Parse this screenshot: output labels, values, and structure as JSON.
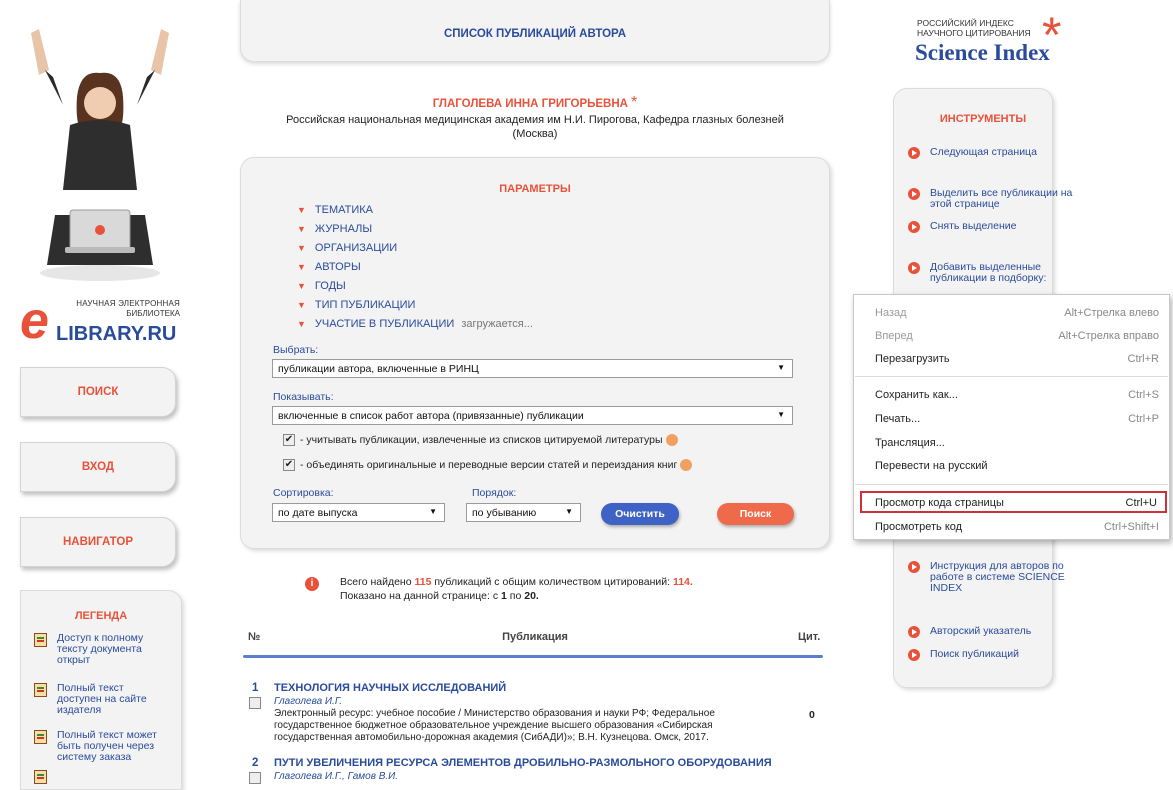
{
  "header": {
    "title": "СПИСОК ПУБЛИКАЦИЙ АВТОРА"
  },
  "logo": {
    "line1": "НАУЧНАЯ ЭЛЕКТРОННАЯ",
    "line2": "БИБЛИОТЕКА",
    "brand": "LIBRARY.RU",
    "brand_letter": "e"
  },
  "science_index": {
    "line1": "РОССИЙСКИЙ ИНДЕКС",
    "line2": "НАУЧНОГО ЦИТИРОВАНИЯ",
    "title": "Science Index",
    "asterisk": "*"
  },
  "nav": {
    "search": "ПОИСК",
    "login": "ВХОД",
    "navigator": "НАВИГАТОР"
  },
  "author": {
    "name": "ГЛАГОЛЕВА ИННА ГРИГОРЬЕВНА",
    "asterisk": "*",
    "affiliation": "Российская национальная медицинская академия им Н.И. Пирогова, Кафедра глазных болезней",
    "city": "(Москва)"
  },
  "params": {
    "title": "ПАРАМЕТРЫ",
    "items": [
      "ТЕМАТИКА",
      "ЖУРНАЛЫ",
      "ОРГАНИЗАЦИИ",
      "АВТОРЫ",
      "ГОДЫ",
      "ТИП ПУБЛИКАЦИИ",
      "УЧАСТИЕ В ПУБЛИКАЦИИ"
    ],
    "loading": "загружается...",
    "select_label": "Выбрать:",
    "select_value": "публикации автора, включенные в РИНЦ",
    "show_label": "Показывать:",
    "show_value": "включенные в список работ автора (привязанные) публикации",
    "check1": "- учитывать публикации, извлеченные из списков цитируемой литературы",
    "check2": "- объединять оригинальные и переводные версии статей и переиздания книг",
    "check_mark": "✔",
    "sort_label": "Сортировка:",
    "sort_value": "по дате выпуска",
    "order_label": "Порядок:",
    "order_value": "по убыванию",
    "clear_button": "Очистить",
    "search_button": "Поиск",
    "arrow": "▼",
    "tri": "▼"
  },
  "summary": {
    "part1": "Всего найдено",
    "total": "115",
    "part2": "публикаций с общим количеством цитирований:",
    "citations": "114.",
    "line2a": "Показано на данной странице: с",
    "from": "1",
    "line2b": "по",
    "to": "20."
  },
  "table": {
    "col_num": "№",
    "col_pub": "Публикация",
    "col_cit": "Цит.",
    "rows": [
      {
        "num": "1",
        "title": "ТЕХНОЛОГИЯ НАУЧНЫХ ИССЛЕДОВАНИЙ",
        "authors": "Глаголева И.Г.",
        "desc1": "Электронный ресурс: учебное пособие / Министерство образования и науки РФ; Федеральное",
        "desc2": "государственное бюджетное образовательное учреждение высшего образования «Сибирская",
        "desc3": "государственная автомобильно-дорожная академия (СибАДИ)»; В.Н. Кузнецова. Омск, 2017.",
        "cit": "0"
      },
      {
        "num": "2",
        "title": "ПУТИ УВЕЛИЧЕНИЯ РЕСУРСА ЭЛЕМЕНТОВ ДРОБИЛЬНО-РАЗМОЛЬНОГО ОБОРУДОВАНИЯ",
        "authors": "Глаголева И.Г., Гамов В.И."
      }
    ]
  },
  "tools": {
    "title": "ИНСТРУМЕНТЫ",
    "next": "Следующая страница",
    "select_all_1": "Выделить все публикации на",
    "select_all_2": "этой странице",
    "deselect": "Снять выделение",
    "add_1": "Добавить выделенные",
    "add_2": "публикации в подборку:",
    "instr_1": "Инструкция для авторов по",
    "instr_2": "работе в системе SCIENCE",
    "instr_3": "INDEX",
    "author_index": "Авторский указатель",
    "pub_search": "Поиск публикаций"
  },
  "legend": {
    "title": "ЛЕГЕНДА",
    "items": [
      {
        "l1": "Доступ к полному",
        "l2": "тексту документа",
        "l3": "открыт"
      },
      {
        "l1": "Полный текст",
        "l2": "доступен на сайте",
        "l3": "издателя"
      },
      {
        "l1": "Полный текст может",
        "l2": "быть получен через",
        "l3": "систему заказа"
      }
    ]
  },
  "context_menu": {
    "items": [
      {
        "label": "Назад",
        "shortcut": "Alt+Стрелка влево"
      },
      {
        "label": "Вперед",
        "shortcut": "Alt+Стрелка вправо"
      },
      {
        "label": "Перезагрузить",
        "shortcut": "Ctrl+R"
      },
      {
        "label": "Сохранить как...",
        "shortcut": "Ctrl+S"
      },
      {
        "label": "Печать...",
        "shortcut": "Ctrl+P"
      },
      {
        "label": "Трансляция...",
        "shortcut": ""
      },
      {
        "label": "Перевести на русский",
        "shortcut": ""
      },
      {
        "label": "Просмотр кода страницы",
        "shortcut": "Ctrl+U"
      },
      {
        "label": "Просмотреть код",
        "shortcut": "Ctrl+Shift+I"
      }
    ]
  },
  "colors": {
    "accent": "#e8523a",
    "link": "#2a4b9b",
    "clear_button": "#3f63c4",
    "search_button": "#ee6a4a",
    "highlight": "#d0303a"
  }
}
